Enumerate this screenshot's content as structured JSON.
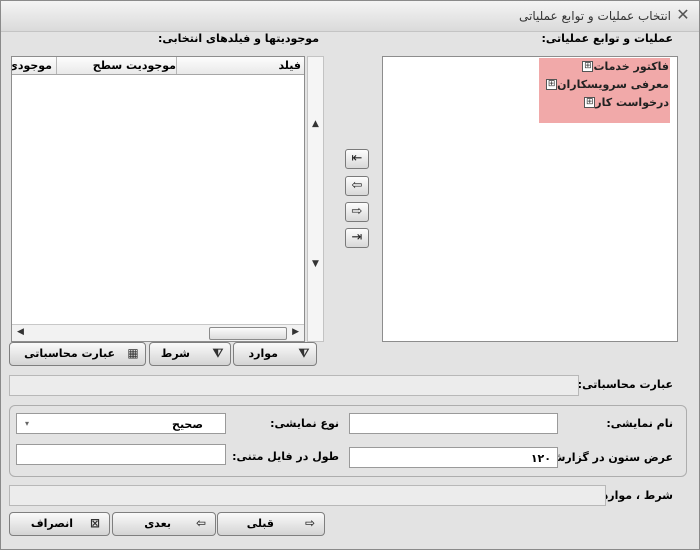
{
  "window": {
    "title": "انتخاب عملیات و توابع عملیاتی",
    "close_glyph": "✕"
  },
  "labels": {
    "operations_panel": "عملیات و توابع عملیاتی:",
    "selected_panel": "موجودیتها و فیلدهای انتخابی:",
    "calc_expression": "عبارت محاسباتی:",
    "display_name": "نام نمایشی:",
    "display_type": "نوع نمایشی:",
    "column_width": "عرض ستون در گزارش:",
    "text_file_length": "طول در فایل متنی:",
    "condition_items": "شرط ، موارد:"
  },
  "tree": {
    "items": [
      "فاکتور خدمات",
      "معرفی سرویسکاران",
      "درخواست کار"
    ],
    "expander": "⊞"
  },
  "grid": {
    "columns": [
      "فیلد",
      "موجودیت سطح",
      "موجودی"
    ]
  },
  "move_buttons": {
    "add_all": "⇤",
    "add": "⇦",
    "remove": "⇨",
    "remove_all": "⇥"
  },
  "panel_buttons": {
    "items": "موارد",
    "condition": "شرط",
    "calc": "عبارت محاسباتی"
  },
  "fields": {
    "display_name_value": "",
    "display_type_value": "صحیح",
    "column_width_value": "۱۲۰",
    "text_file_length_value": "",
    "calc_expression_value": "",
    "condition_value": ""
  },
  "footer_buttons": {
    "prev": "قبلی",
    "next": "بعدی",
    "cancel": "انصراف"
  },
  "icons": {
    "funnel": "filter-icon",
    "calc": "calculator-icon",
    "cancel": "cancel-icon",
    "left_arrow": "⇦",
    "right_arrow": "⇨",
    "dropdown": "▾"
  }
}
